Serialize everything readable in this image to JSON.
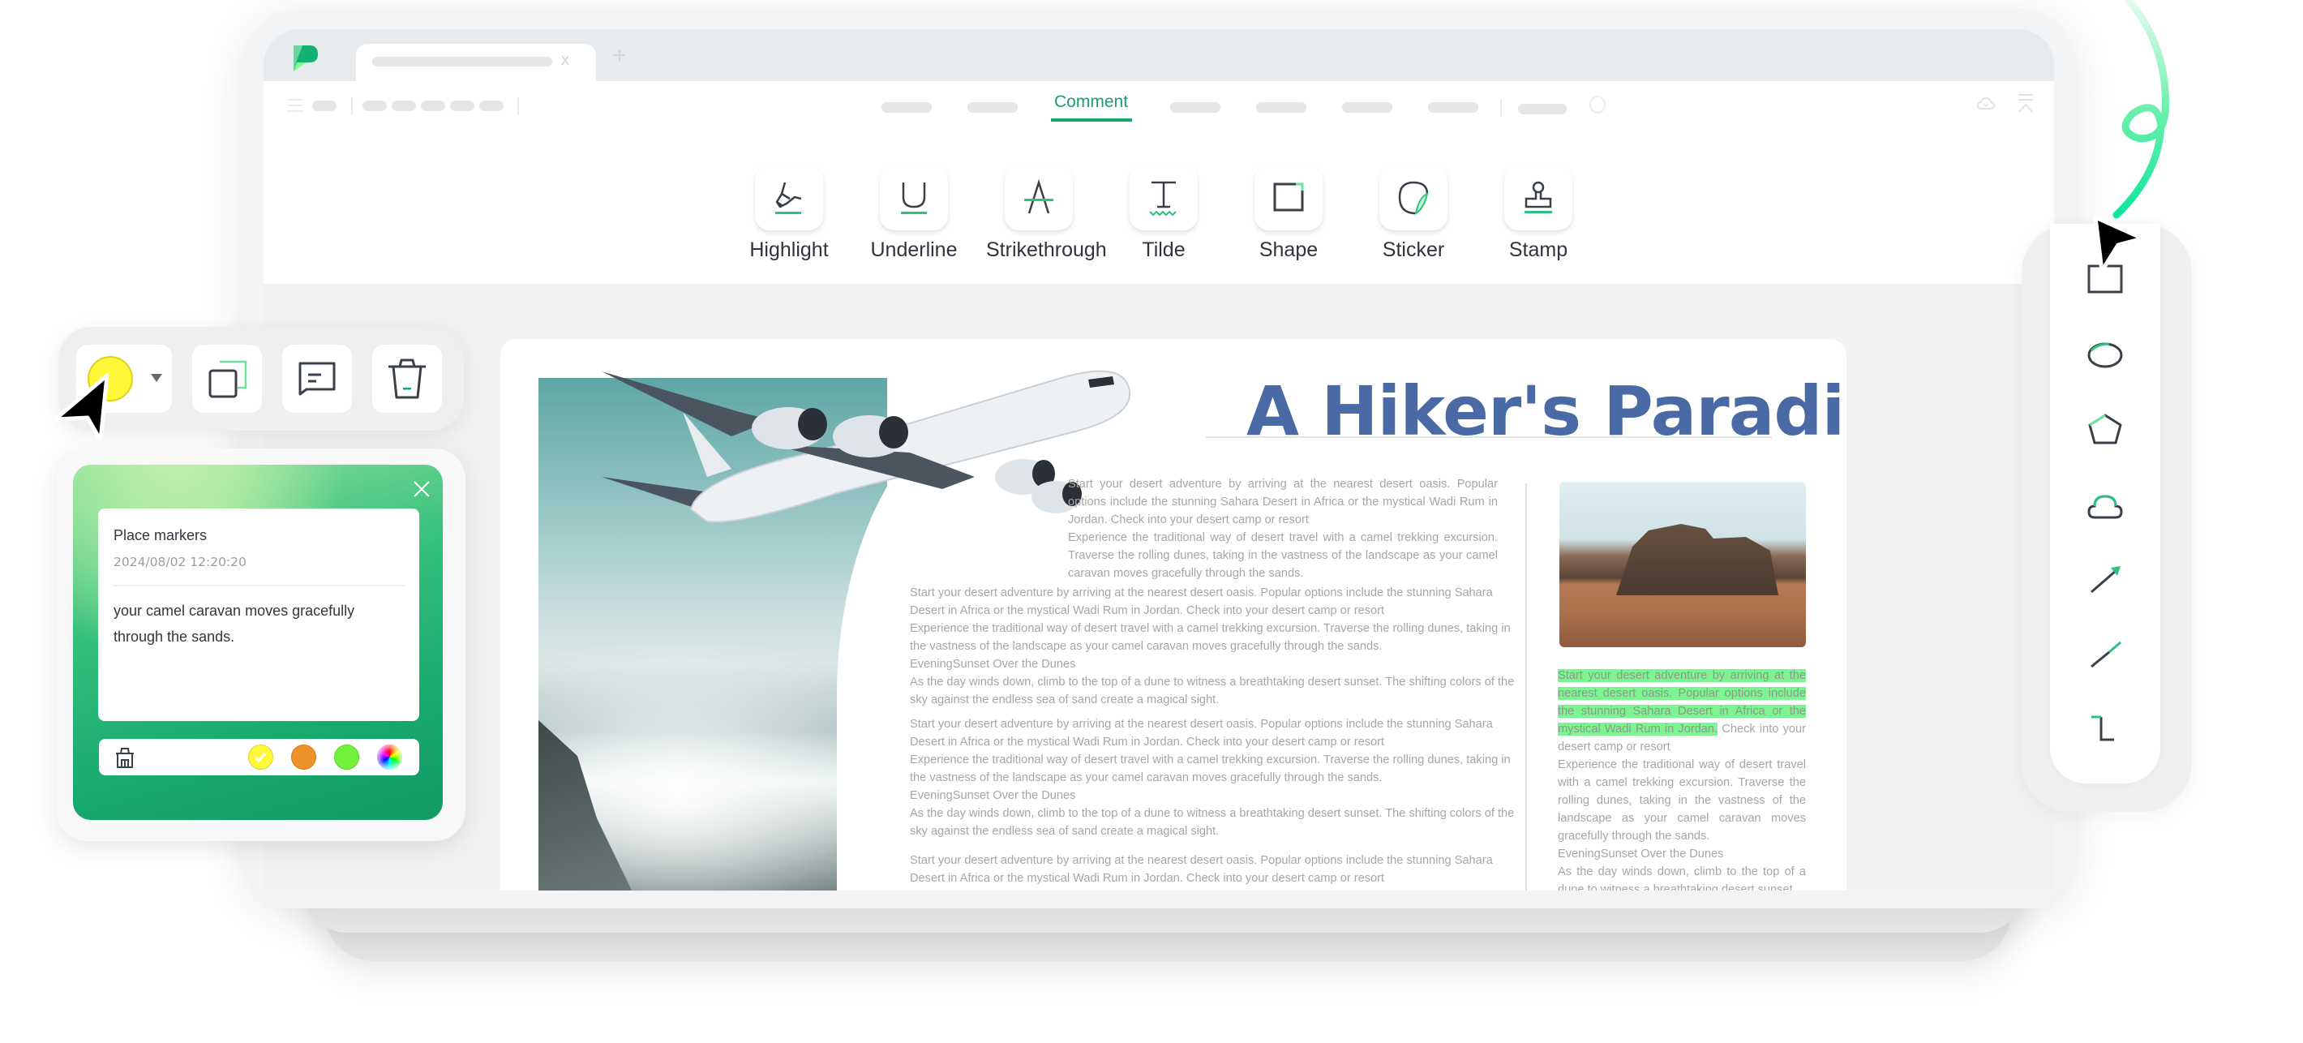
{
  "app": {
    "brand_color": "#11a86c",
    "tab_close_glyph": "x",
    "new_tab_glyph": "+"
  },
  "menubar": {
    "active_tab": "Comment"
  },
  "ribbon": {
    "tools": [
      {
        "label": "Highlight",
        "icon": "highlighter-icon"
      },
      {
        "label": "Underline",
        "icon": "underline-icon"
      },
      {
        "label": "Strikethrough",
        "icon": "strikethrough-icon"
      },
      {
        "label": "Tilde",
        "icon": "tilde-text-icon"
      },
      {
        "label": "Shape",
        "icon": "shape-rectangle-icon"
      },
      {
        "label": "Sticker",
        "icon": "sticker-icon"
      },
      {
        "label": "Stamp",
        "icon": "stamp-icon"
      }
    ]
  },
  "document": {
    "title": "A Hiker's Paradise",
    "top_column": [
      "Start your desert adventure by arriving at the nearest desert oasis. Popular options include the stunning Sahara Desert in Africa or the mystical Wadi Rum in Jordan. Check into your desert camp or resort",
      "Experience the traditional way of desert travel with a camel trekking excursion. Traverse the rolling dunes, taking in the vastness of the landscape as your camel caravan moves gracefully through the sands."
    ],
    "main_blocks": [
      {
        "p1": "Start your desert adventure by arriving at the nearest desert oasis. Popular options include the stunning Sahara Desert in Africa or the mystical Wadi Rum in Jordan. Check into your desert camp or resort",
        "p2": "Experience the traditional way of desert travel with a camel trekking excursion. Traverse the rolling dunes, taking in the vastness of the landscape as your camel caravan moves gracefully through the sands.",
        "heading": "EveningSunset Over the Dunes",
        "p3": "As the day winds down, climb to the top of a dune to witness a breathtaking desert sunset. The shifting colors of the sky against the endless sea of sand create a magical sight."
      },
      {
        "p1": "Start your desert adventure by arriving at the nearest desert oasis. Popular options include the stunning Sahara Desert in Africa or the mystical Wadi Rum in Jordan. Check into your desert camp or resort",
        "p2": "Experience the traditional way of desert travel with a camel trekking excursion. Traverse the rolling dunes, taking in the vastness of the landscape as your camel caravan moves gracefully through the sands.",
        "heading": "EveningSunset Over the Dunes",
        "p3": "As the day winds down, climb to the top of a dune to witness a breathtaking desert sunset. The shifting colors of the sky against the endless sea of sand create a magical sight."
      },
      {
        "p1": "Start your desert adventure by arriving at the nearest desert oasis. Popular options include the stunning Sahara Desert in Africa or the mystical Wadi Rum in Jordan. Check into your desert camp or resort"
      }
    ],
    "side_column": {
      "highlighted": "Start your desert adventure by arriving at the nearest desert oasis. Popular options include the stunning Sahara Desert in Africa or the mystical Wadi Rum in Jordan.",
      "after_highlight": " Check into your desert camp or resort",
      "p2": "Experience the traditional way of desert travel with a camel trekking excursion. Traverse the rolling dunes, taking in the vastness of the landscape as your camel caravan moves gracefully through the sands.",
      "heading": "EveningSunset Over the Dunes",
      "p3": "As the day winds down, climb to the top of a dune to witness a breathtaking desert sunset."
    },
    "highlight_color": "#7cf590",
    "title_color": "#4a6aa6"
  },
  "float_toolbar": {
    "selected_color": "#fff839",
    "buttons": [
      "color-picker",
      "duplicate",
      "add-comment",
      "delete"
    ]
  },
  "note": {
    "title": "Place markers",
    "timestamp": "2024/08/02 12:20:20",
    "body": "your camel caravan moves gracefully through the sands.",
    "swatches": [
      {
        "name": "yellow",
        "color": "#fff83b",
        "selected": true
      },
      {
        "name": "orange",
        "color": "#ee922a",
        "selected": false
      },
      {
        "name": "green",
        "color": "#72f03a",
        "selected": false
      },
      {
        "name": "custom",
        "color": "rainbow",
        "selected": false
      }
    ]
  },
  "shape_toolbar": {
    "items": [
      "rectangle",
      "ellipse",
      "polygon",
      "cloud",
      "arrow",
      "line",
      "polyline"
    ]
  }
}
